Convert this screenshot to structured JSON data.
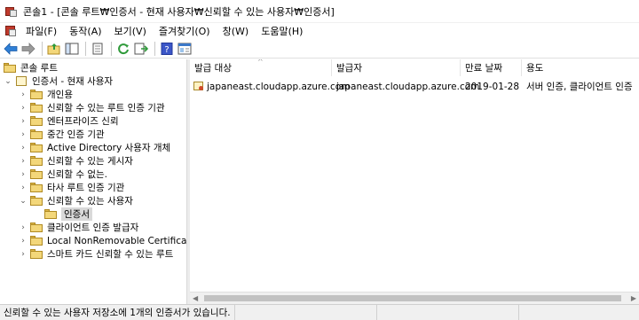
{
  "window": {
    "title": "콘솔1 - [콘솔 루트₩인증서 - 현재 사용자₩신뢰할 수 있는 사용자₩인증서]"
  },
  "menubar": {
    "items": [
      "파일(F)",
      "동작(A)",
      "보기(V)",
      "즐겨찾기(O)",
      "창(W)",
      "도움말(H)"
    ]
  },
  "toolbar": {
    "icons": [
      "back-icon",
      "forward-icon",
      "up-folder-icon",
      "show-hide-tree-icon",
      "copy-icon",
      "refresh-icon",
      "export-list-icon",
      "help-icon",
      "properties-icon"
    ]
  },
  "tree": {
    "root": "콘솔 루트",
    "store": "인증서 - 현재 사용자",
    "folders": [
      "개인용",
      "신뢰할 수 있는 루트 인증 기관",
      "엔터프라이즈 신뢰",
      "중간 인증 기관",
      "Active Directory 사용자 개체",
      "신뢰할 수 있는 게시자",
      "신뢰할 수 없는.",
      "타사 루트 인증 기관",
      "신뢰할 수 있는 사용자"
    ],
    "selected_child": "인증서",
    "folders_after": [
      "클라이언트 인증 발급자",
      "Local NonRemovable Certificates",
      "스마트 카드 신뢰할 수 있는 루트"
    ]
  },
  "list": {
    "columns": [
      "발급 대상",
      "발급자",
      "만료 날짜",
      "용도"
    ],
    "rows": [
      {
        "issued_to": "japaneast.cloudapp.azure.com",
        "issued_by": "japaneast.cloudapp.azure.com",
        "expiry": "2019-01-28",
        "purpose": "서버 인증, 클라이언트 인증"
      }
    ]
  },
  "status": {
    "text": "신뢰할 수 있는 사용자 저장소에 1개의 인증서가 있습니다."
  }
}
